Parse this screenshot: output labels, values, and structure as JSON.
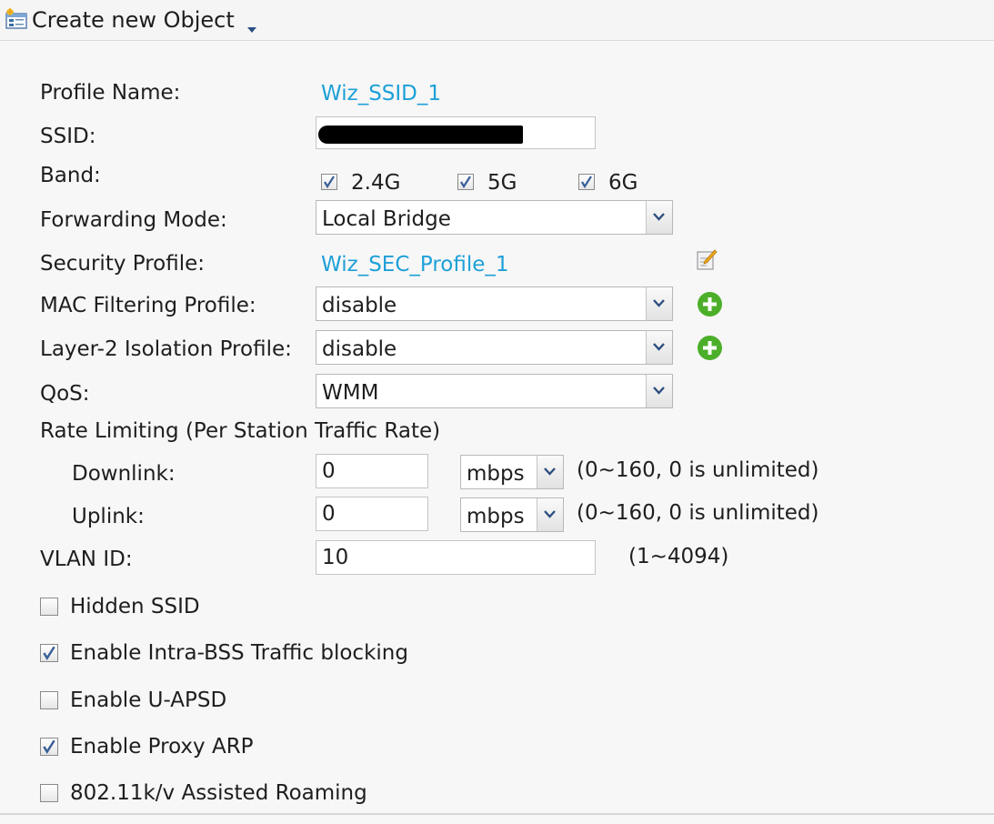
{
  "toolbar": {
    "create_label": "Create new Object"
  },
  "form": {
    "profile_name": {
      "label": "Profile Name:",
      "value": "Wiz_SSID_1"
    },
    "ssid": {
      "label": "SSID:",
      "value": ""
    },
    "band": {
      "label": "Band:",
      "options": [
        {
          "label": "2.4G",
          "checked": true
        },
        {
          "label": "5G",
          "checked": true
        },
        {
          "label": "6G",
          "checked": true
        }
      ]
    },
    "forwarding_mode": {
      "label": "Forwarding Mode:",
      "value": "Local Bridge"
    },
    "security_profile": {
      "label": "Security Profile:",
      "value": "Wiz_SEC_Profile_1"
    },
    "mac_filtering": {
      "label": "MAC Filtering Profile:",
      "value": "disable"
    },
    "l2_isolation": {
      "label": "Layer-2 Isolation Profile:",
      "value": "disable"
    },
    "qos": {
      "label": "QoS:",
      "value": "WMM"
    },
    "rate_limiting": {
      "heading": "Rate Limiting (Per Station Traffic Rate)",
      "downlink": {
        "label": "Downlink:",
        "value": "0",
        "unit": "mbps",
        "hint": "(0~160, 0 is unlimited)"
      },
      "uplink": {
        "label": "Uplink:",
        "value": "0",
        "unit": "mbps",
        "hint": "(0~160, 0 is unlimited)"
      }
    },
    "vlan_id": {
      "label": "VLAN ID:",
      "value": "10",
      "hint": "(1~4094)"
    },
    "options": [
      {
        "label": "Hidden SSID",
        "checked": false
      },
      {
        "label": "Enable Intra-BSS Traffic blocking",
        "checked": true
      },
      {
        "label": "Enable U-APSD",
        "checked": false
      },
      {
        "label": "Enable Proxy ARP",
        "checked": true
      },
      {
        "label": "802.11k/v Assisted Roaming",
        "checked": false
      }
    ]
  },
  "colors": {
    "link": "#1ea0d8",
    "add_button": "#4caf2a"
  }
}
